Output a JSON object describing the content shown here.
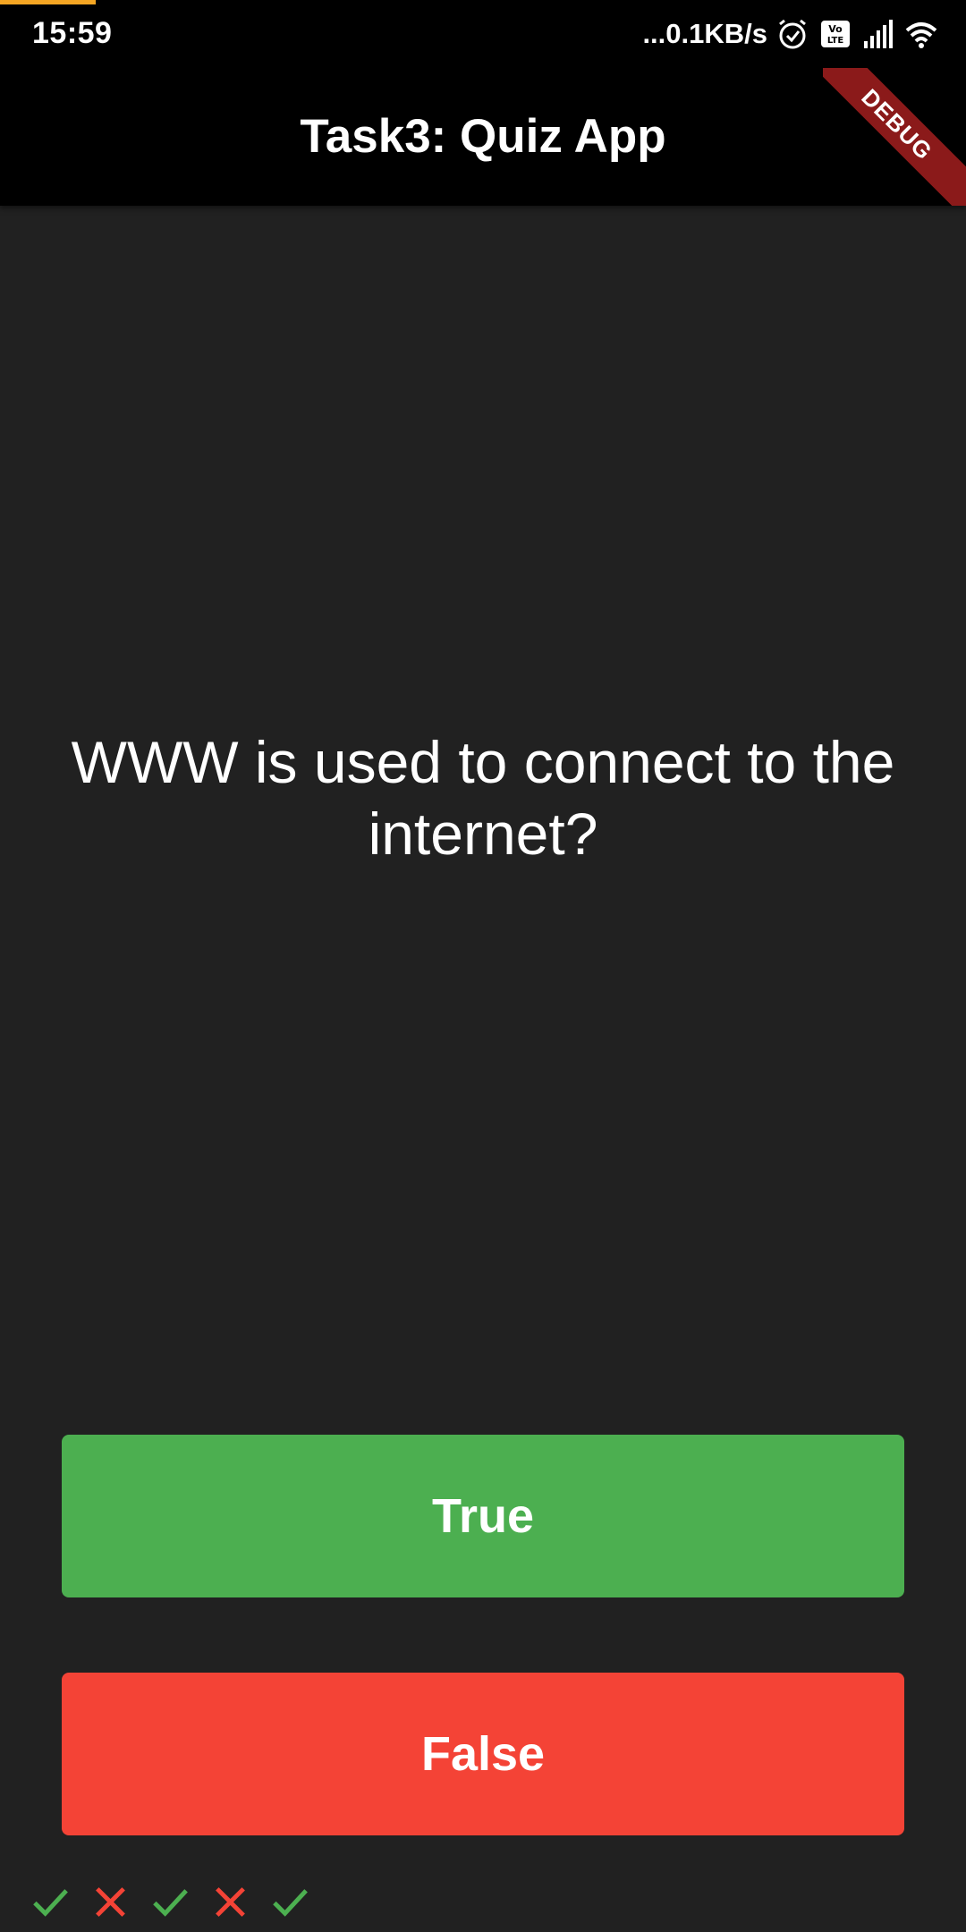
{
  "status_bar": {
    "time": "15:59",
    "network_speed": "...0.1KB/s",
    "icons": [
      "alarm-icon",
      "volte-icon",
      "signal-icon",
      "wifi-icon"
    ],
    "accent_color": "#f5a623"
  },
  "app_bar": {
    "title": "Task3: Quiz App",
    "debug_label": "DEBUG"
  },
  "quiz": {
    "question": "WWW is used to connect to the internet?",
    "true_label": "True",
    "false_label": "False"
  },
  "colors": {
    "background": "#212121",
    "app_bar": "#000000",
    "true_button": "#4caf50",
    "false_button": "#f44336",
    "correct_icon": "#4caf50",
    "wrong_icon": "#f44336",
    "debug_banner": "#8b1a1a"
  },
  "score_keeper": [
    {
      "icon": "check-icon",
      "result": "correct"
    },
    {
      "icon": "close-icon",
      "result": "wrong"
    },
    {
      "icon": "check-icon",
      "result": "correct"
    },
    {
      "icon": "close-icon",
      "result": "wrong"
    },
    {
      "icon": "check-icon",
      "result": "correct"
    }
  ]
}
